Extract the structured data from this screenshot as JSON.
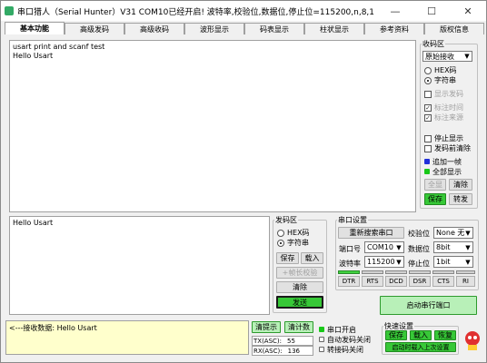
{
  "window": {
    "title": "串口猎人（Serial Hunter）V31    COM10已经开启!   波特率,校验位,数据位,停止位=115200,n,8,1",
    "min_glyph": "—",
    "max_glyph": "☐",
    "close_glyph": "✕"
  },
  "tabs": [
    "基本功能",
    "高级发码",
    "高级收码",
    "波形显示",
    "码表显示",
    "柱状显示",
    "参考资料",
    "版权信息"
  ],
  "receive": {
    "text_line1": "usart print and scanf test",
    "text_line2": "Hello Usart"
  },
  "recv_group": {
    "title": "收码区",
    "mode_select": "原始接收",
    "radio_hex": "HEX码",
    "radio_str": "字符串",
    "chk_show_code": "显示发码",
    "chk_timestamp": "标注时间",
    "chk_source": "标注来源",
    "chk_stop_display": "停止显示",
    "chk_clear_before_send": "发码前清除",
    "legend_append": "追加一帧",
    "legend_all": "全部显示",
    "btn_select_all": "全显",
    "btn_clear": "清除",
    "btn_save": "保存",
    "btn_swap": "转发"
  },
  "send": {
    "text": "Hello Usart"
  },
  "send_group": {
    "title": "发码区",
    "radio_hex": "HEX码",
    "radio_str": "字符串",
    "btn_save": "保存",
    "btn_load": "载入",
    "btn_checksum": "+帧长校验",
    "btn_clear": "清除",
    "btn_send": "发送"
  },
  "port_group": {
    "title": "串口设置",
    "btn_rescan": "重新搜索串口",
    "label_parity": "校验位",
    "parity": "None 无",
    "label_port": "端口号",
    "port": "COM10",
    "label_databits": "数据位",
    "databits": "8bit",
    "label_baud": "波特率",
    "baud": "115200",
    "label_stopbits": "停止位",
    "stopbits": "1bit",
    "signals": [
      "DTR",
      "RTS",
      "DCD",
      "DSR",
      "CTS",
      "RI"
    ],
    "btn_open": "启动串行端口"
  },
  "status": {
    "recv_label": "<---接收数据:",
    "recv_data": "Hello Usart",
    "btn_clear_hint": "清提示",
    "btn_clear_count": "清计数",
    "tx_label": "TX(ASC):",
    "tx_count": "55",
    "rx_label": "RX(ASC):",
    "rx_count": "136",
    "ind_port_open": "串口开启",
    "ind_auto_send": "自动发码关闭",
    "ind_auto_recv": "转接码关闭"
  },
  "quick": {
    "title": "快速设置",
    "btn_save": "保存",
    "btn_load": "载入",
    "btn_restore": "恢复",
    "btn_load_last": "启动时载入上次设置"
  },
  "colors": {
    "green": "#37c837",
    "blue_led": "#1f2fd9",
    "green_led": "#18c818",
    "status_bg": "#ffffcc"
  }
}
